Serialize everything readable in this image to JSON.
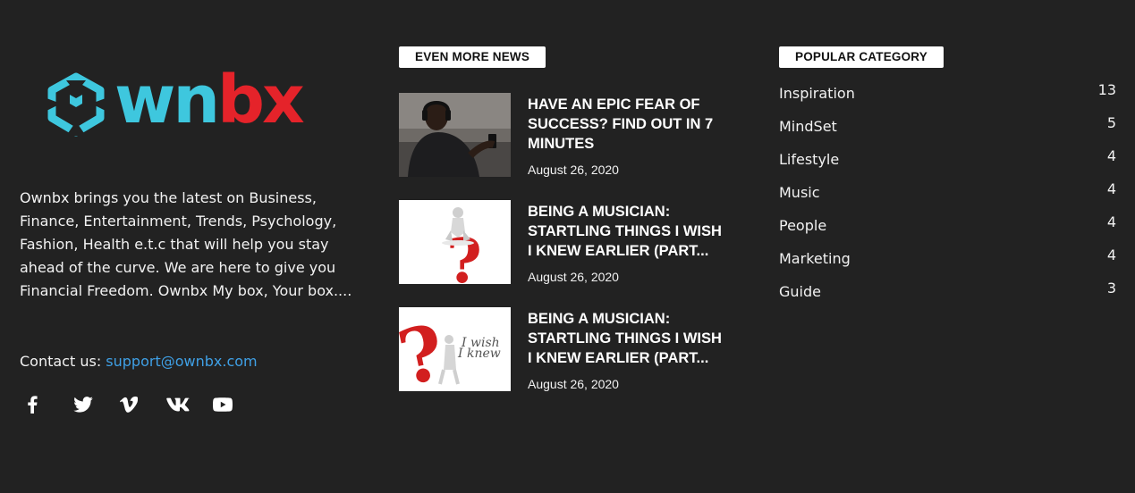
{
  "about": {
    "logo_text_left": "wn",
    "logo_text_right": "bx",
    "description": "Ownbx brings you the latest on Business, Finance, Entertainment, Trends, Psychology, Fashion, Health e.t.c that will help you stay ahead of the curve. We are here to give you Financial Freedom. Ownbx My box, Your box....",
    "contact_label": "Contact us:",
    "contact_email": "support@ownbx.com",
    "social_icons": [
      "facebook-icon",
      "twitter-icon",
      "vimeo-icon",
      "vk-icon",
      "youtube-icon"
    ]
  },
  "news": {
    "section_label": "EVEN MORE NEWS",
    "items": [
      {
        "title": "HAVE AN EPIC FEAR OF SUCCESS? FIND OUT IN 7 MINUTES",
        "date": "August 26, 2020"
      },
      {
        "title": "BEING A MUSICIAN: STARTLING THINGS I WISH I KNEW EARLIER (PART...",
        "date": "August 26, 2020"
      },
      {
        "title": "BEING A MUSICIAN: STARTLING THINGS I WISH I KNEW EARLIER (PART...",
        "date": "August 26, 2020",
        "thumb_text_1": "I wish",
        "thumb_text_2": "I knew"
      }
    ]
  },
  "categories": {
    "section_label": "POPULAR CATEGORY",
    "items": [
      {
        "name": "Inspiration",
        "count": "13"
      },
      {
        "name": "MindSet",
        "count": "5"
      },
      {
        "name": "Lifestyle",
        "count": "4"
      },
      {
        "name": "Music",
        "count": "4"
      },
      {
        "name": "People",
        "count": "4"
      },
      {
        "name": "Marketing",
        "count": "4"
      },
      {
        "name": "Guide",
        "count": "3"
      }
    ]
  },
  "colors": {
    "background": "#222222",
    "logo_cyan": "#3ec7de",
    "logo_red": "#e5232a",
    "link": "#3fa0e6"
  }
}
